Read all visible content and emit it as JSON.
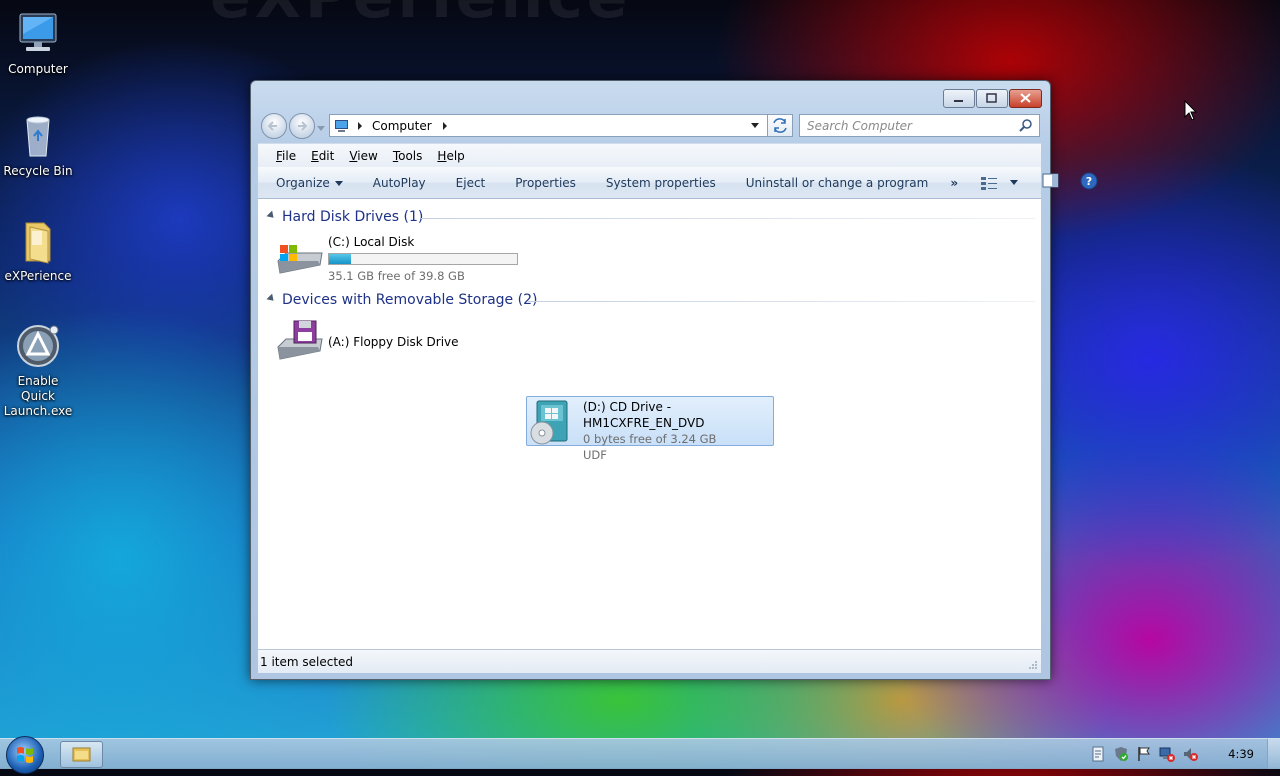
{
  "desktop": {
    "icons": [
      {
        "label": "Computer"
      },
      {
        "label": "Recycle Bin"
      },
      {
        "label": "eXPerience"
      },
      {
        "label": "Enable Quick\nLaunch.exe",
        "line1": "Enable Quick",
        "line2": "Launch.exe"
      }
    ]
  },
  "window": {
    "address": {
      "crumb": "Computer"
    },
    "search": {
      "placeholder": "Search Computer"
    },
    "menu": [
      "File",
      "Edit",
      "View",
      "Tools",
      "Help"
    ],
    "commands": {
      "organize": "Organize",
      "autoplay": "AutoPlay",
      "eject": "Eject",
      "properties": "Properties",
      "system_properties": "System properties",
      "uninstall": "Uninstall or change a program",
      "more": "»"
    },
    "groups": {
      "hdd": {
        "title": "Hard Disk Drives (1)",
        "drives": [
          {
            "name": "(C:) Local Disk",
            "free": "35.1 GB free of 39.8 GB",
            "used_fraction": 0.118
          }
        ]
      },
      "removable": {
        "title": "Devices with Removable Storage (2)",
        "drives": [
          {
            "name": "(A:) Floppy Disk Drive"
          },
          {
            "name": "(D:) CD Drive - HM1CXFRE_EN_DVD",
            "free": "0 bytes free of 3.24 GB",
            "fs": "UDF",
            "selected": true
          }
        ]
      }
    },
    "status": "1 item selected"
  },
  "taskbar": {
    "clock": "4:39"
  },
  "colors": {
    "group_header": "#1e3287",
    "selection": "#c9e0f8",
    "bar_fill": "#26a6d8"
  }
}
